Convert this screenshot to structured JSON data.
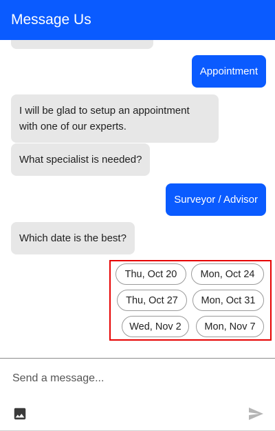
{
  "header": {
    "title": "Message Us"
  },
  "messages": [
    {
      "from": "user",
      "text": "Appointment"
    },
    {
      "from": "bot",
      "lines": [
        "I will be glad to setup an appointment",
        "with one of our experts."
      ]
    },
    {
      "from": "bot",
      "text": "What specialist is needed?"
    },
    {
      "from": "user",
      "text": "Surveyor / Advisor"
    },
    {
      "from": "bot",
      "text": "Which date is the best?"
    }
  ],
  "date_options": [
    "Thu, Oct 20",
    "Mon, Oct 24",
    "Thu, Oct 27",
    "Mon, Oct 31",
    "Wed, Nov 2",
    "Mon, Nov 7"
  ],
  "composer": {
    "placeholder": "Send a message...",
    "image_icon": "image-icon",
    "send_icon": "send-icon"
  },
  "colors": {
    "brand": "#0a5bff",
    "bot_bubble": "#e7e7e7",
    "highlight": "#e60000"
  }
}
